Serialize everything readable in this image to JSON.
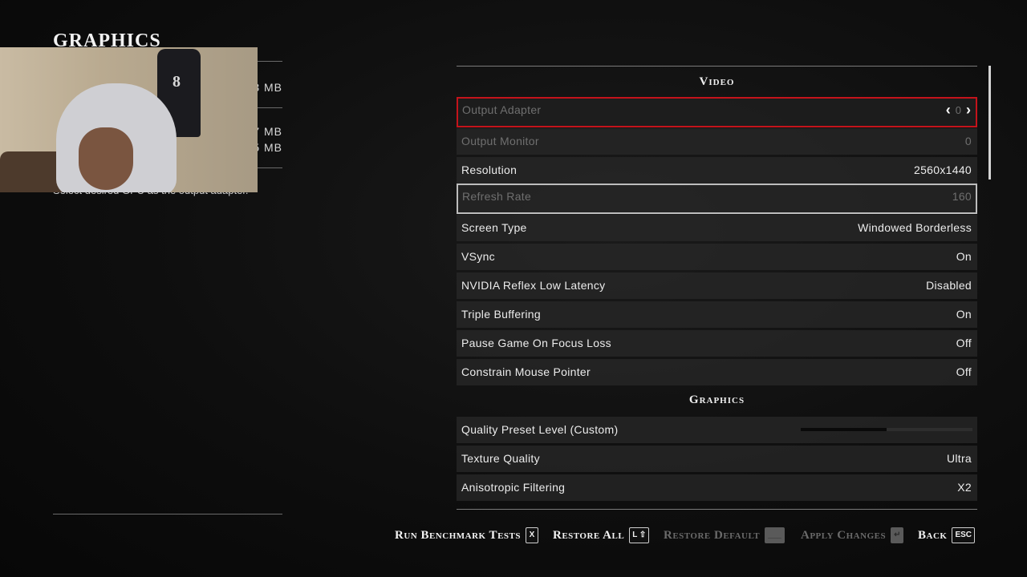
{
  "left": {
    "title": "GRAPHICS",
    "mem_1": "3 MB",
    "mem_2": "7 MB",
    "mem_3": "5 MB",
    "description": "Select desired GPU as the output adapter."
  },
  "webcam": {
    "jersey_number": "8"
  },
  "sections": {
    "video": "Video",
    "graphics": "Graphics"
  },
  "rows": {
    "output_adapter": {
      "label": "Output Adapter",
      "value": "0"
    },
    "output_monitor": {
      "label": "Output Monitor",
      "value": "0"
    },
    "resolution": {
      "label": "Resolution",
      "value": "2560x1440"
    },
    "refresh_rate": {
      "label": "Refresh Rate",
      "value": "160"
    },
    "screen_type": {
      "label": "Screen Type",
      "value": "Windowed Borderless"
    },
    "vsync": {
      "label": "VSync",
      "value": "On"
    },
    "reflex": {
      "label": "NVIDIA Reflex Low Latency",
      "value": "Disabled"
    },
    "triple_buffering": {
      "label": "Triple Buffering",
      "value": "On"
    },
    "pause_on_focus": {
      "label": "Pause Game On Focus Loss",
      "value": "Off"
    },
    "constrain_mouse": {
      "label": "Constrain Mouse Pointer",
      "value": "Off"
    },
    "quality_preset": {
      "label": "Quality Preset Level (Custom)",
      "level": 0.5
    },
    "texture_quality": {
      "label": "Texture Quality",
      "value": "Ultra"
    },
    "anisotropic": {
      "label": "Anisotropic Filtering",
      "value": "X2"
    }
  },
  "footer": {
    "benchmark": {
      "label": "Run Benchmark Tests",
      "key": "X"
    },
    "restore_all": {
      "label": "Restore All",
      "key": "L ⇧"
    },
    "restore_default": {
      "label": "Restore Default",
      "key": "___"
    },
    "apply_changes": {
      "label": "Apply Changes",
      "key": "↵"
    },
    "back": {
      "label": "Back",
      "key": "ESC"
    }
  },
  "colors": {
    "selected_border": "#c4131b",
    "hover_border": "#bdbdbd"
  }
}
